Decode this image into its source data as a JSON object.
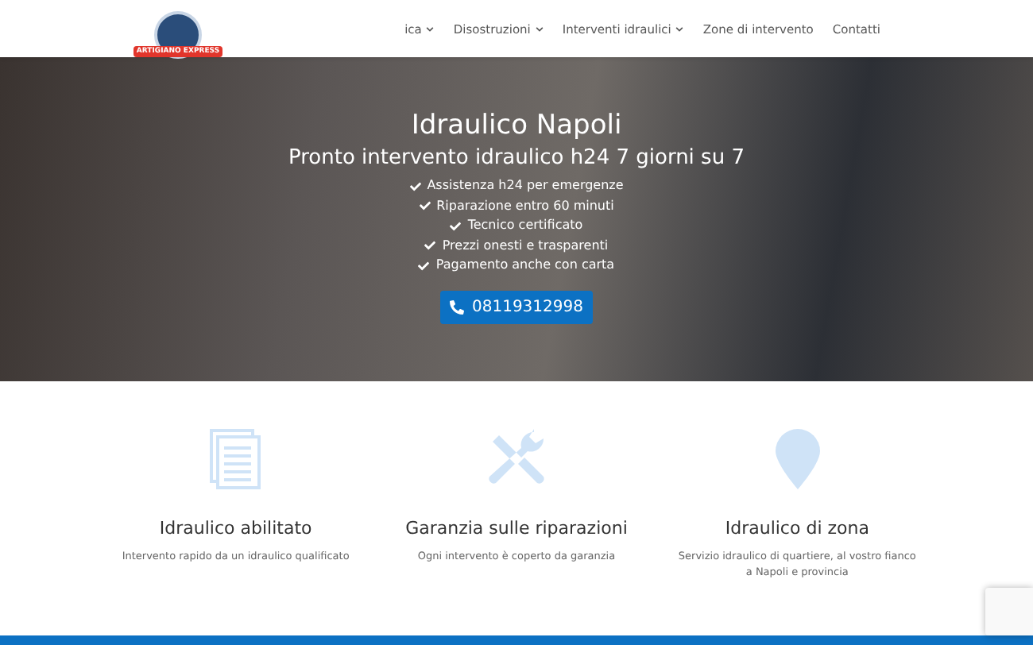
{
  "header": {
    "logo_text": "ARTIGIANO EXPRESS",
    "menu": [
      {
        "label": "ica",
        "has_submenu": true
      },
      {
        "label": "Disostruzioni",
        "has_submenu": true
      },
      {
        "label": "Interventi idraulici",
        "has_submenu": true
      },
      {
        "label": "Zone di intervento",
        "has_submenu": false
      },
      {
        "label": "Contatti",
        "has_submenu": false
      }
    ]
  },
  "hero": {
    "title": "Idraulico Napoli",
    "subtitle": "Pronto intervento idraulico h24 7 giorni su 7",
    "points": [
      "Assistenza h24 per emergenze",
      "Riparazione entro 60 minuti",
      "Tecnico certificato",
      "Prezzi onesti e trasparenti",
      "Pagamento anche con carta"
    ],
    "phone_button": "08119312998"
  },
  "features": [
    {
      "kind": "document",
      "title": "Idraulico abilitato",
      "text": "Intervento rapido da un idraulico qualificato"
    },
    {
      "kind": "tools",
      "title": "Garanzia sulle riparazioni",
      "text": "Ogni intervento è coperto da garanzia"
    },
    {
      "kind": "pin",
      "title": "Idraulico di zona",
      "text": "Servizio idraulico di quartiere, al vostro fianco a Napoli e provincia"
    }
  ]
}
